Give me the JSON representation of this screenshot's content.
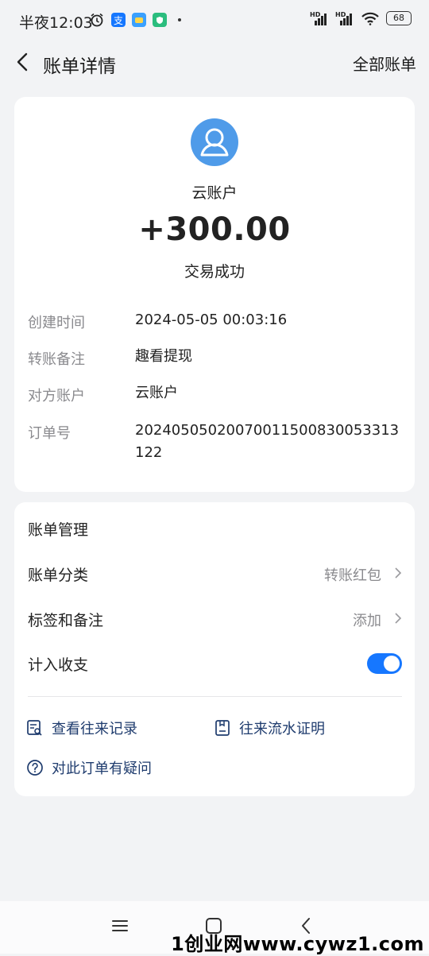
{
  "status_bar": {
    "time": "半夜12:03",
    "battery": "68"
  },
  "header": {
    "title": "账单详情",
    "right_action": "全部账单"
  },
  "transaction": {
    "name": "云账户",
    "amount": "+300.00",
    "status": "交易成功",
    "details": [
      {
        "label": "创建时间",
        "value": "2024-05-05 00:03:16"
      },
      {
        "label": "转账备注",
        "value": "趣看提现"
      },
      {
        "label": "对方账户",
        "value": "云账户"
      },
      {
        "label": "订单号",
        "value": "20240505020070011500830053313122"
      }
    ]
  },
  "management": {
    "title": "账单管理",
    "category_label": "账单分类",
    "category_value": "转账红包",
    "tag_label": "标签和备注",
    "tag_value": "添加",
    "include_label": "计入收支",
    "include_on": true,
    "records_link": "查看往来记录",
    "proof_link": "往来流水证明",
    "question_link": "对此订单有疑问"
  },
  "watermark": "1创业网www.cywz1.com",
  "colors": {
    "accent": "#1677ff",
    "avatar": "#4f9be9",
    "link": "#1f3c6e"
  }
}
